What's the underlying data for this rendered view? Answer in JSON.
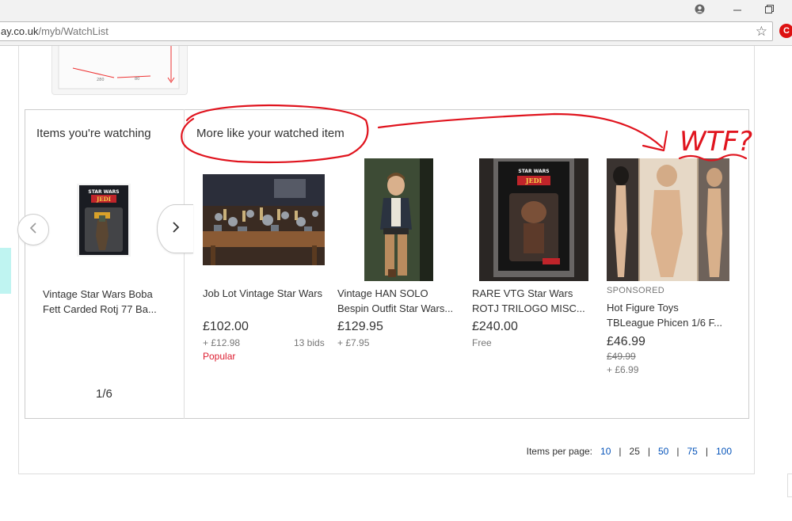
{
  "browser": {
    "url_host": "ay.co.uk",
    "url_path": "/myb/WatchList",
    "ext_label": "C"
  },
  "watching": {
    "heading": "Items you're watching",
    "item": {
      "title_line1": "Vintage Star Wars Boba",
      "title_line2": "Fett Carded Rotj 77 Ba..."
    },
    "counter": "1/6",
    "prev_icon": "chevron-left-icon",
    "next_icon": "chevron-right-icon"
  },
  "similar": {
    "heading": "More like your watched item",
    "items": [
      {
        "title_line1": "Job Lot Vintage Star Wars",
        "title_line2": "",
        "price": "£102.00",
        "shipping": "+ £12.98",
        "bids": "13 bids",
        "badge": "Popular"
      },
      {
        "title_line1": "Vintage HAN SOLO",
        "title_line2": "Bespin Outfit Star Wars...",
        "price": "£129.95",
        "shipping": "+ £7.95"
      },
      {
        "title_line1": "RARE VTG Star Wars",
        "title_line2": "ROTJ TRILOGO MISC...",
        "price": "£240.00",
        "shipping": "Free"
      },
      {
        "sponsored": "SPONSORED",
        "title_line1": "Hot Figure Toys",
        "title_line2": "TBLeague Phicen 1/6 F...",
        "price": "£46.99",
        "was_price": "£49.99",
        "shipping": "+ £6.99"
      }
    ]
  },
  "pagination": {
    "label": "Items per page:",
    "options": [
      "10",
      "25",
      "50",
      "75",
      "100"
    ],
    "current": "25"
  },
  "annotation": {
    "text": "WTF?",
    "color": "#e0141e"
  }
}
